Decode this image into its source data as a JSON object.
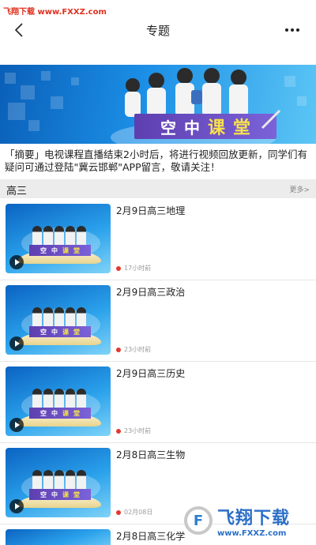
{
  "watermark_top": "飞翔下载 www.FXXZ.com",
  "header": {
    "title": "专题"
  },
  "banner": {
    "title_chars": [
      "空",
      "中",
      "课",
      "堂"
    ]
  },
  "notice": "「摘要」电视课程直播结束2小时后，将进行视频回放更新，同学们有疑问可通过登陆\"冀云邯郸\"APP留言，敬请关注！",
  "section": {
    "title": "高三",
    "more_label": "更多>"
  },
  "items": [
    {
      "title": "2月9日高三地理",
      "time": "17小时前"
    },
    {
      "title": "2月9日高三政治",
      "time": "23小时前"
    },
    {
      "title": "2月9日高三历史",
      "time": "23小时前"
    },
    {
      "title": "2月8日高三生物",
      "time": "02月08日"
    },
    {
      "title": "2月8日高三化学",
      "time": ""
    }
  ],
  "thumb_plate_chars": [
    "空",
    "中",
    "课",
    "堂"
  ],
  "watermark_bottom": {
    "cn": "飞翔下载",
    "url": "www.FXXZ.com"
  },
  "colors": {
    "accent_red": "#e03a2f",
    "banner_blue": "#1c8fe6",
    "plate_purple": "#6a4fc4",
    "title_yellow": "#f8e24a"
  }
}
